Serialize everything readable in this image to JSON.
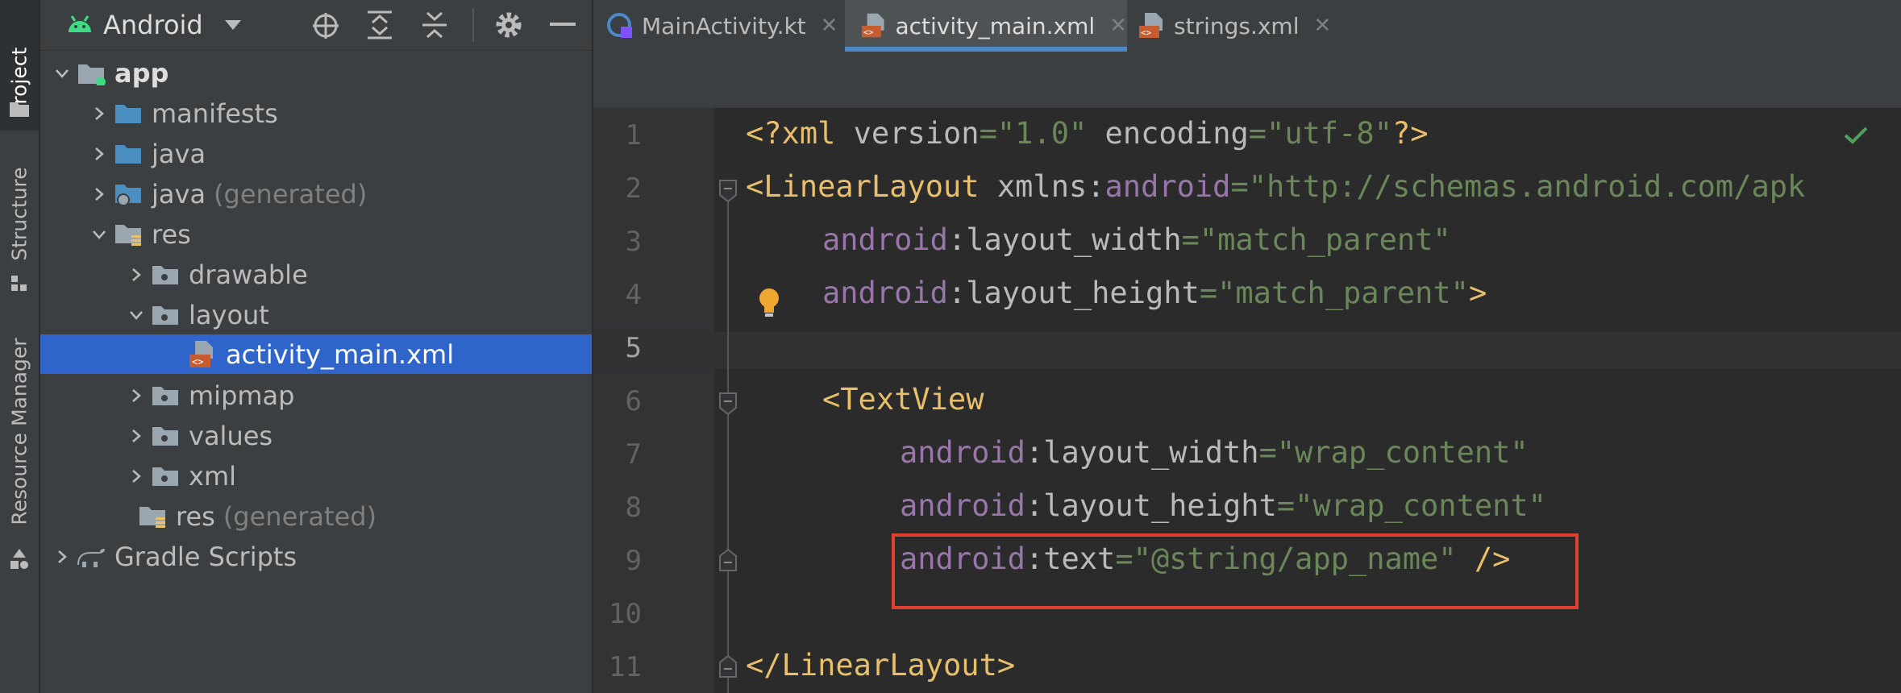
{
  "toolstrip": {
    "project_label": "Project",
    "structure_label": "Structure",
    "resource_manager_label": "Resource Manager"
  },
  "project_panel": {
    "view_mode": "Android",
    "tree": [
      {
        "label": "app",
        "suffix": "",
        "expanded": true
      },
      {
        "label": "manifests",
        "suffix": "",
        "expanded": false
      },
      {
        "label": "java",
        "suffix": "",
        "expanded": false
      },
      {
        "label": "java",
        "suffix": "(generated)",
        "expanded": false
      },
      {
        "label": "res",
        "suffix": "",
        "expanded": true
      },
      {
        "label": "drawable",
        "suffix": "",
        "expanded": false
      },
      {
        "label": "layout",
        "suffix": "",
        "expanded": true
      },
      {
        "label": "activity_main.xml",
        "suffix": "",
        "selected": true
      },
      {
        "label": "mipmap",
        "suffix": "",
        "expanded": false
      },
      {
        "label": "values",
        "suffix": "",
        "expanded": false
      },
      {
        "label": "xml",
        "suffix": "",
        "expanded": false
      },
      {
        "label": "res",
        "suffix": "(generated)"
      },
      {
        "label": "Gradle Scripts",
        "suffix": "",
        "expanded": false
      }
    ]
  },
  "editor": {
    "tabs": [
      {
        "label": "MainActivity.kt",
        "active": false
      },
      {
        "label": "activity_main.xml",
        "active": true
      },
      {
        "label": "strings.xml",
        "active": false
      }
    ],
    "close_glyph": "✕",
    "line_numbers": [
      "1",
      "2",
      "3",
      "4",
      "5",
      "6",
      "7",
      "8",
      "9",
      "10",
      "11"
    ],
    "code": {
      "l1": {
        "a": "<?xml ",
        "b": "version",
        "c": "=",
        "d": "\"1.0\"",
        "e": " ",
        "f": "encoding",
        "g": "=",
        "h": "\"utf-8\"",
        "i": "?>"
      },
      "l2": {
        "a": "<LinearLayout ",
        "b": "xmlns:",
        "c": "android",
        "d": "=",
        "e": "\"http://schemas.android.com/apk"
      },
      "l3": {
        "a": "android",
        "b": ":layout_width",
        "c": "=",
        "d": "\"match_parent\""
      },
      "l4": {
        "a": "android",
        "b": ":layout_height",
        "c": "=",
        "d": "\"match_parent\"",
        "e": ">"
      },
      "l6": {
        "a": "<TextView"
      },
      "l7": {
        "a": "android",
        "b": ":layout_width",
        "c": "=",
        "d": "\"wrap_content\""
      },
      "l8": {
        "a": "android",
        "b": ":layout_height",
        "c": "=",
        "d": "\"wrap_content\""
      },
      "l9": {
        "a": "android",
        "b": ":text",
        "c": "=",
        "d": "\"@string/app_name\"",
        "e": " />"
      },
      "l11": {
        "a": "</LinearLayout>"
      }
    }
  },
  "colors": {
    "selection": "#2f65ca",
    "tab_underline": "#4a88c7",
    "highlight_box": "#e0402f",
    "xml_tag": "#e8bf6a",
    "xml_attr": "#9876aa",
    "xml_value": "#6a8759"
  }
}
